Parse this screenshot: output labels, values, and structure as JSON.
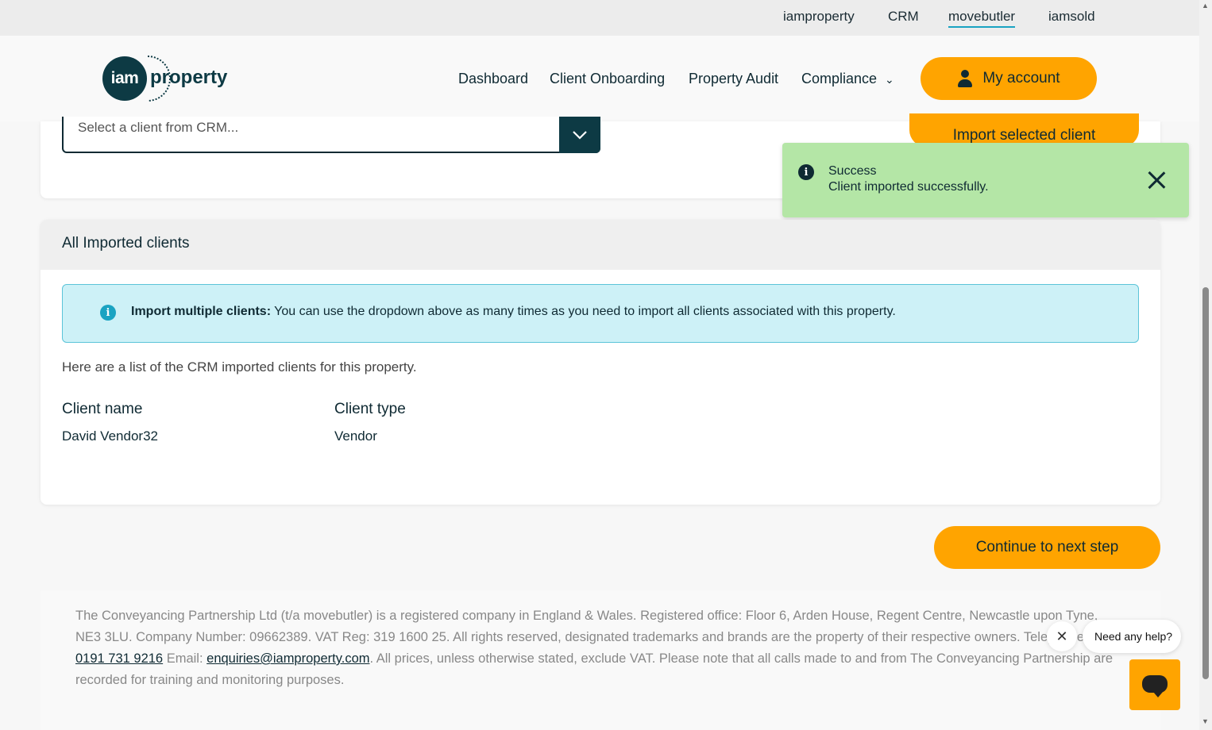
{
  "topbar": {
    "links": [
      "iamproperty",
      "CRM",
      "movebutler",
      "iamsold"
    ],
    "active": "movebutler"
  },
  "header": {
    "logo_iam": "iam",
    "logo_property": "property",
    "nav": [
      "Dashboard",
      "Client Onboarding",
      "Property Audit",
      "Compliance"
    ],
    "account_label": "My account"
  },
  "select_client": {
    "placeholder": "Select a client from CRM...",
    "import_label": "Import selected client"
  },
  "toast": {
    "title": "Success",
    "message": "Client imported successfully."
  },
  "imported": {
    "heading": "All Imported clients",
    "info_bold": "Import multiple clients:",
    "info_text": " You can use the dropdown above as many times as you need to import all clients associated with this property.",
    "intro": "Here are a list of the CRM imported clients for this property.",
    "columns": [
      "Client name",
      "Client type"
    ],
    "rows": [
      {
        "name": "David Vendor32",
        "type": "Vendor"
      }
    ]
  },
  "continue_label": "Continue to next step",
  "footer": {
    "text_1": "The Conveyancing Partnership Ltd (t/a movebutler) is a registered company in England & Wales. Registered office: Floor 6, Arden House, Regent Centre, Newcastle upon Tyne, NE3 3LU. Company Number: 09662389. VAT Reg: 319 1600 25. All rights reserved, designated trademarks and brands are the property of their respective owners. Telephone: ",
    "phone": "0191 731 9216",
    "text_2": " Email: ",
    "email": "enquiries@iamproperty.com",
    "text_3": ". All prices, unless otherwise stated, exclude VAT. Please note that all calls made to and from The Conveyancing Partnership are recorded for training and monitoring purposes."
  },
  "help": {
    "bubble": "Need any help?",
    "close": "✕"
  }
}
